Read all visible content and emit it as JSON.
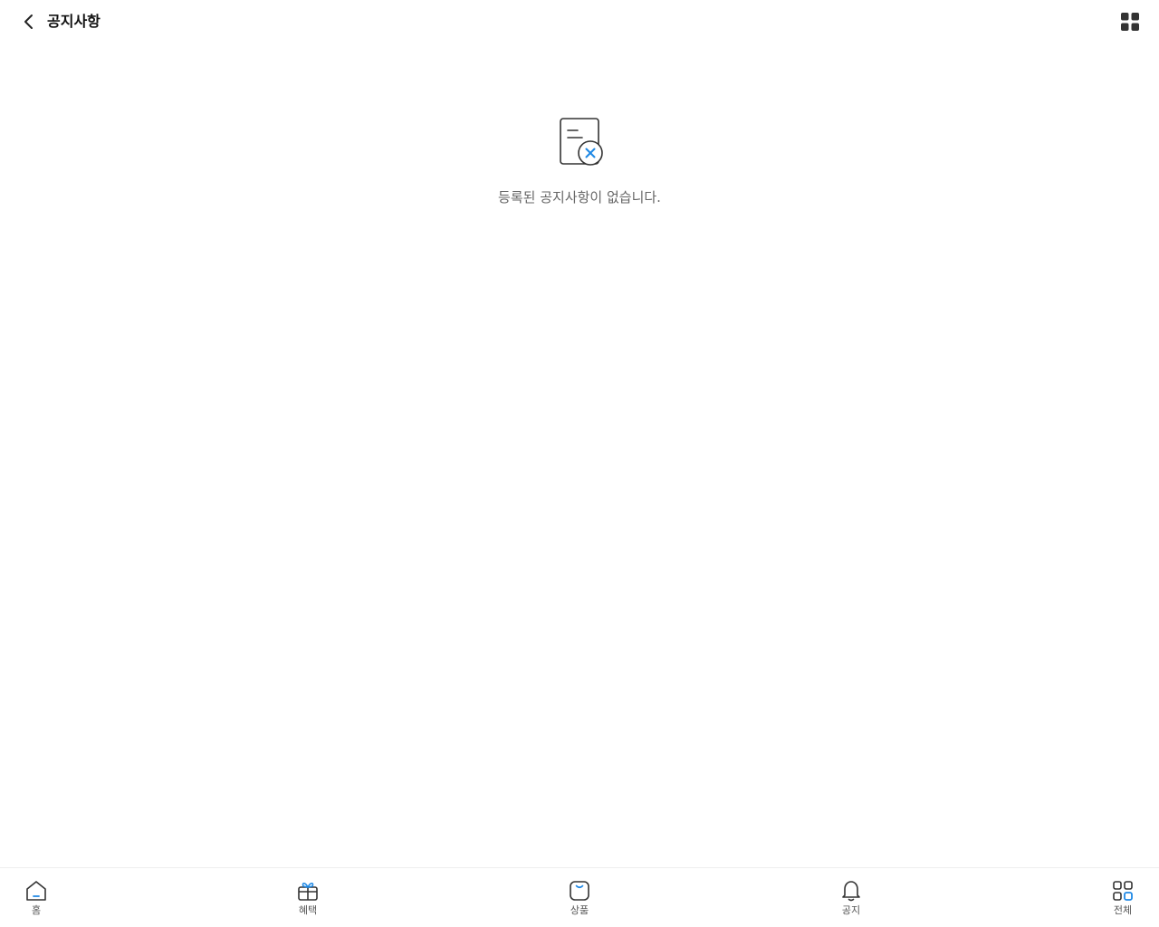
{
  "header": {
    "title": "공지사항",
    "back_icon": "chevron-left-icon",
    "menu_icon": "grid-menu-icon"
  },
  "empty_state": {
    "icon": "document-x-icon",
    "message": "등록된 공지사항이 없습니다."
  },
  "bottom_nav": {
    "items": [
      {
        "label": "홈",
        "icon": "home-icon"
      },
      {
        "label": "혜택",
        "icon": "gift-icon"
      },
      {
        "label": "상품",
        "icon": "shopping-bag-icon"
      },
      {
        "label": "공지",
        "icon": "bell-icon"
      },
      {
        "label": "전체",
        "icon": "grid-icon"
      }
    ]
  },
  "colors": {
    "accent": "#1e88e5",
    "icon_stroke": "#333333",
    "text_muted": "#666666"
  }
}
